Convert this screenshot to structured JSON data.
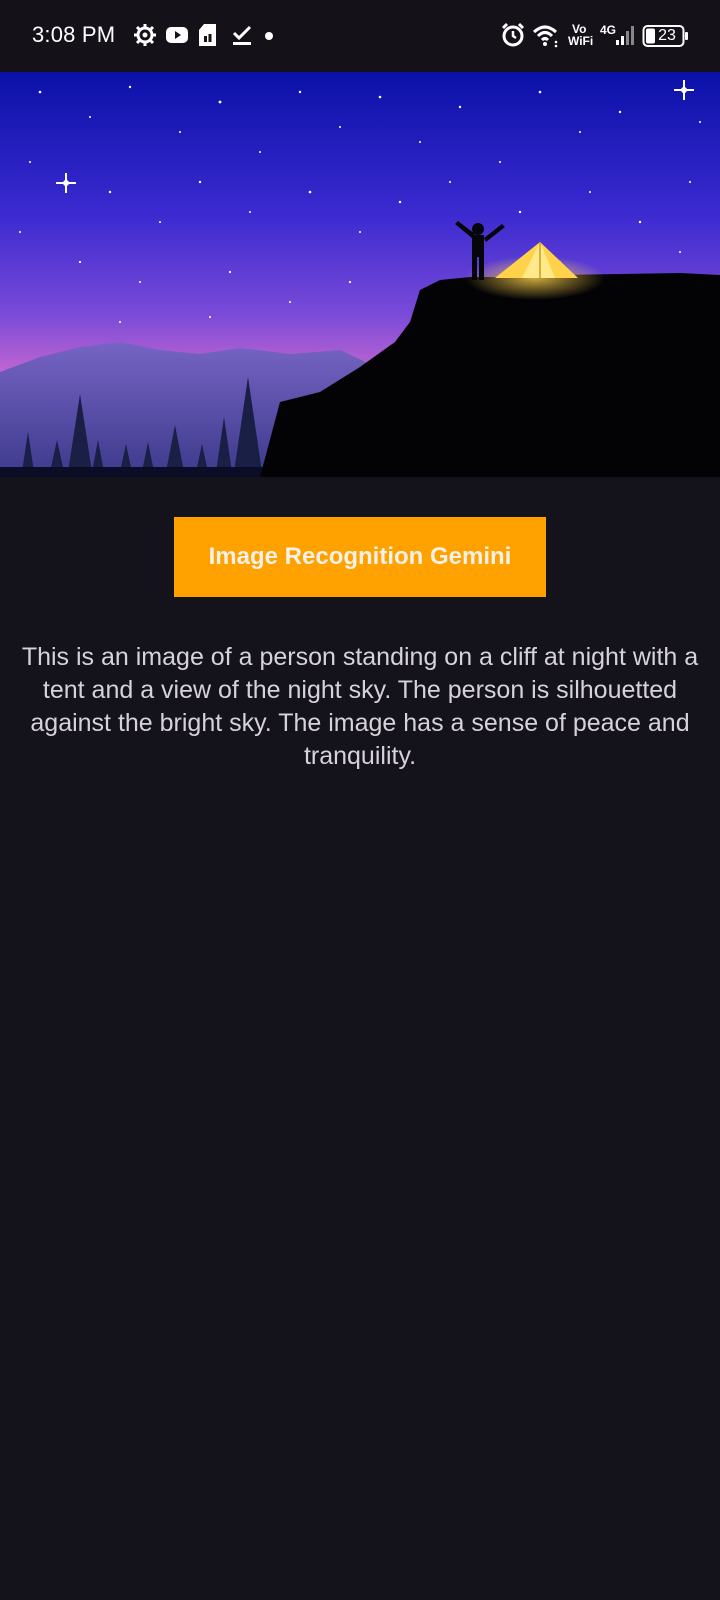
{
  "status_bar": {
    "time": "3:08 PM",
    "network": {
      "vo": "Vo",
      "wifi": "WiFi",
      "cellular": "4G"
    },
    "battery": "23",
    "icons": [
      "settings-gear-icon",
      "youtube-icon",
      "sd-card-icon",
      "download-done-icon",
      "dot-icon",
      "alarm-icon",
      "wifi-icon",
      "signal-icon",
      "battery-icon"
    ]
  },
  "hero": {
    "icon": "night-camping-illustration",
    "colors": {
      "sky_top": "#0a11a8",
      "sky_mid": "#5c3ed6",
      "sky_horizon": "#e070d0",
      "tent": "#ffd24a"
    }
  },
  "main": {
    "button_label": "Image Recognition Gemini",
    "description": "This is an image of a person standing on a cliff at night with a tent and a view of the night sky. The person is silhouetted against the bright sky. The image has a sense of peace and tranquility."
  },
  "theme": {
    "background": "#14121a",
    "accent": "#ffa200"
  }
}
